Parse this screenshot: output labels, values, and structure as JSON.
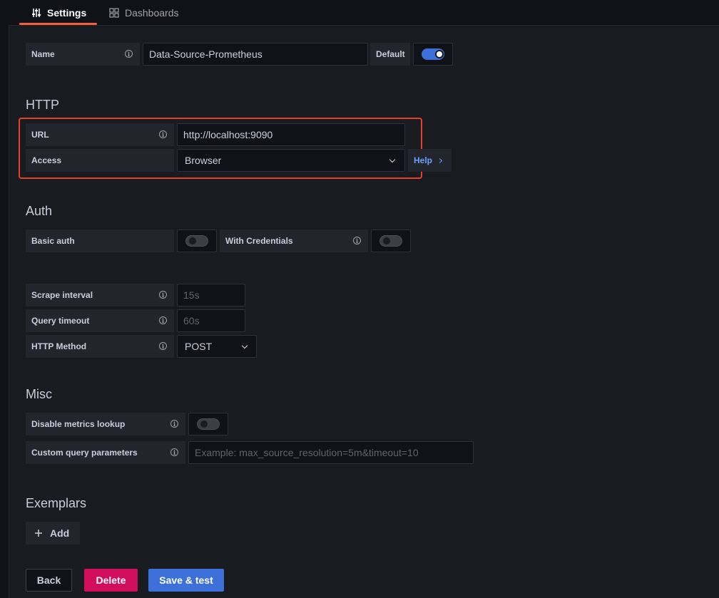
{
  "tabs": [
    {
      "label": "Settings",
      "icon": "sliders-icon",
      "active": true
    },
    {
      "label": "Dashboards",
      "icon": "apps-icon",
      "active": false
    }
  ],
  "name_row": {
    "label": "Name",
    "value": "Data-Source-Prometheus",
    "default_label": "Default",
    "default_on": true
  },
  "http": {
    "title": "HTTP",
    "url_label": "URL",
    "url_value": "http://localhost:9090",
    "access_label": "Access",
    "access_value": "Browser",
    "help_label": "Help"
  },
  "auth": {
    "title": "Auth",
    "basic_auth_label": "Basic auth",
    "basic_auth_on": false,
    "with_credentials_label": "With Credentials",
    "with_credentials_on": false
  },
  "prometheus": {
    "scrape_label": "Scrape interval",
    "scrape_placeholder": "15s",
    "timeout_label": "Query timeout",
    "timeout_placeholder": "60s",
    "method_label": "HTTP Method",
    "method_value": "POST"
  },
  "misc": {
    "title": "Misc",
    "disable_lookup_label": "Disable metrics lookup",
    "disable_lookup_on": false,
    "custom_params_label": "Custom query parameters",
    "custom_params_placeholder": "Example: max_source_resolution=5m&timeout=10"
  },
  "exemplars": {
    "title": "Exemplars",
    "add_label": "Add"
  },
  "footer": {
    "back_label": "Back",
    "delete_label": "Delete",
    "save_label": "Save & test"
  },
  "colors": {
    "accent_tab": "#f55f3e",
    "highlight": "#e5422d",
    "primary": "#3d71d9",
    "destructive": "#d10e5c",
    "link": "#6e9fff"
  }
}
